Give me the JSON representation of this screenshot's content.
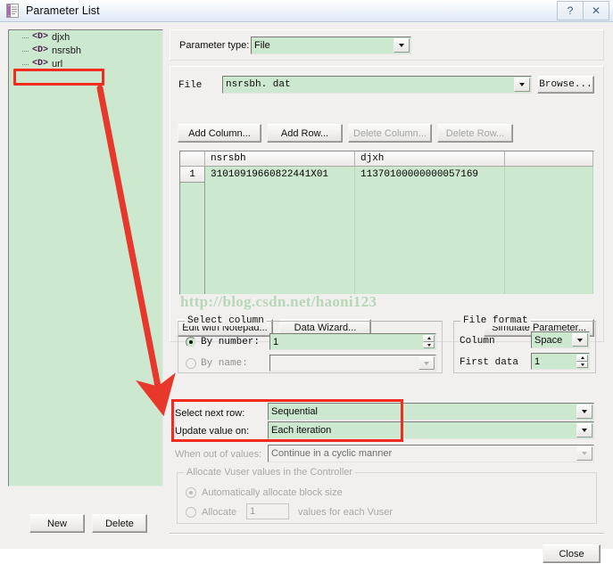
{
  "window": {
    "title": "Parameter List",
    "icon": "document-list-icon",
    "help_button": "?",
    "close_button": "✕"
  },
  "tree": {
    "items": [
      {
        "glyph": "<D>",
        "label": "djxh"
      },
      {
        "glyph": "<D>",
        "label": "nsrsbh"
      },
      {
        "glyph": "<D>",
        "label": "url"
      }
    ],
    "selected": "nsrsbh",
    "new_label": "New",
    "delete_label": "Delete"
  },
  "parameter_type": {
    "label": "Parameter type:",
    "value": "File"
  },
  "file_section": {
    "label": "File",
    "value": "nsrsbh. dat",
    "browse_label": "Browse...",
    "add_column_label": "Add Column...",
    "add_row_label": "Add Row...",
    "delete_column_label": "Delete Column...",
    "delete_row_label": "Delete Row..."
  },
  "grid": {
    "columns": [
      "nsrsbh",
      "djxh"
    ],
    "rows": [
      {
        "number": "1",
        "nsrsbh": "31010919660822441X01",
        "djxh": "11370100000000057169"
      }
    ]
  },
  "watermark": "http://blog.csdn.net/haoni123",
  "tool_buttons": {
    "edit_with_notepad": "Edit with Notepad...",
    "data_wizard": "Data Wizard...",
    "simulate_parameter": "Simulate Parameter..."
  },
  "select_column": {
    "legend": "Select column",
    "by_number_label": "By number:",
    "by_number_value": "1",
    "by_name_label": "By name:",
    "by_name_value": ""
  },
  "file_format": {
    "legend": "File format",
    "column_label": "Column",
    "column_value": "Space",
    "first_data_label": "First data",
    "first_data_value": "1"
  },
  "row_options": {
    "select_next_row_label": "Select next row:",
    "select_next_row_value": "Sequential",
    "update_value_on_label": "Update value on:",
    "update_value_on_value": "Each iteration",
    "when_out_of_values_label": "When out of values:",
    "when_out_of_values_value": "Continue in a cyclic manner"
  },
  "allocate": {
    "legend": "Allocate Vuser values in the Controller",
    "auto_label": "Automatically allocate block size",
    "allocate_label": "Allocate",
    "allocate_value": "1",
    "allocate_suffix": "values for each Vuser"
  },
  "footer": {
    "close_label": "Close"
  },
  "colors": {
    "field_green": "#cce8ce",
    "annotation_red": "#f22a20",
    "dialog_gray": "#f1f0ef",
    "watermark_green": "#b6d7b8"
  }
}
